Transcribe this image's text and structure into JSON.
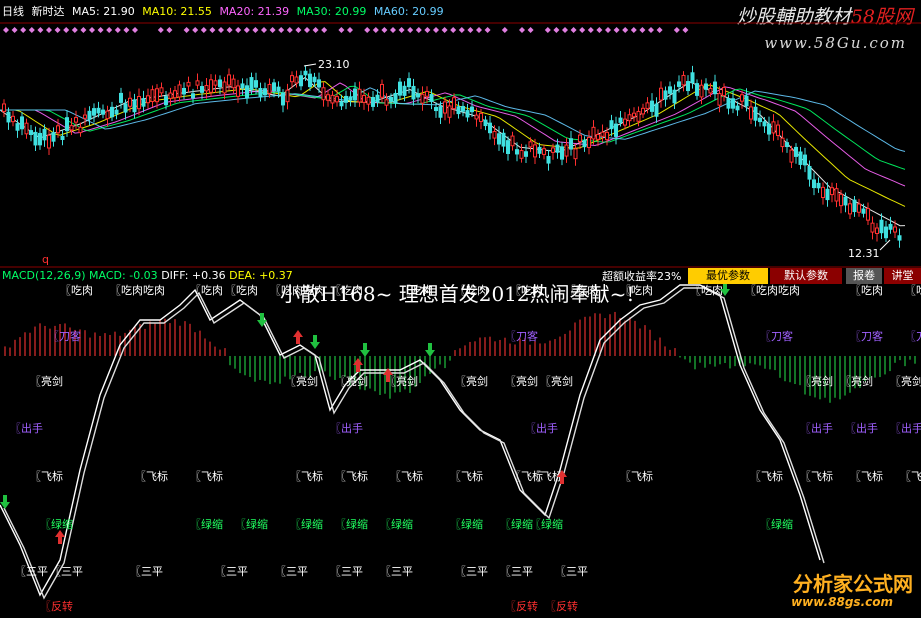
{
  "header": {
    "period": "日线",
    "mode": "新时达",
    "ma": [
      {
        "label": "MA5: 21.90",
        "color": "#ffffff"
      },
      {
        "label": "MA10: 21.55",
        "color": "#ffff00"
      },
      {
        "label": "MA20: 21.39",
        "color": "#ff66ff"
      },
      {
        "label": "MA30: 20.99",
        "color": "#00ff66"
      },
      {
        "label": "MA60: 20.99",
        "color": "#66ccff"
      }
    ]
  },
  "watermark": {
    "title_a": "炒股輔助教材",
    "title_b": "58股网",
    "url": "www.58Gu.com",
    "site_a": "分析家公式网",
    "site_b": "www.88gs.com"
  },
  "macd_header": {
    "name": "MACD(12,26,9)",
    "macd": "MACD: -0.03",
    "diff": "DIFF: +0.36",
    "dea": "DEA: +0.37"
  },
  "q_marker": "q",
  "excess_return": "超额收益率23%",
  "buttons": [
    {
      "label": "最优参数"
    },
    {
      "label": "默认参数"
    },
    {
      "label": "报卷"
    },
    {
      "label": "讲堂"
    }
  ],
  "banner": "小散H168~ 理想首发2012热闹奉献~!",
  "chart_data": [
    {
      "type": "candlestick",
      "title": "",
      "annotations": [
        {
          "label": "23.10",
          "value": 23.1,
          "note": "high"
        },
        {
          "label": "12.31",
          "value": 12.31,
          "note": "low"
        }
      ],
      "series": [
        {
          "name": "MA5",
          "color": "#ffffff"
        },
        {
          "name": "MA10",
          "color": "#ffff00"
        },
        {
          "name": "MA20",
          "color": "#ff66ff"
        },
        {
          "name": "MA30",
          "color": "#00ff66"
        },
        {
          "name": "MA60",
          "color": "#66ccff"
        }
      ]
    },
    {
      "type": "line",
      "title": "",
      "signal_labels": {
        "row1": "〖吃肉",
        "row1_var": "〖吃肉吃肉",
        "row2": "〖刀客",
        "row3": "〖亮剑",
        "row4": "〖出手",
        "row5": "〖飞标",
        "row6": "〖绿缩",
        "row7": "〖三平",
        "row8": "〖反转"
      }
    }
  ]
}
